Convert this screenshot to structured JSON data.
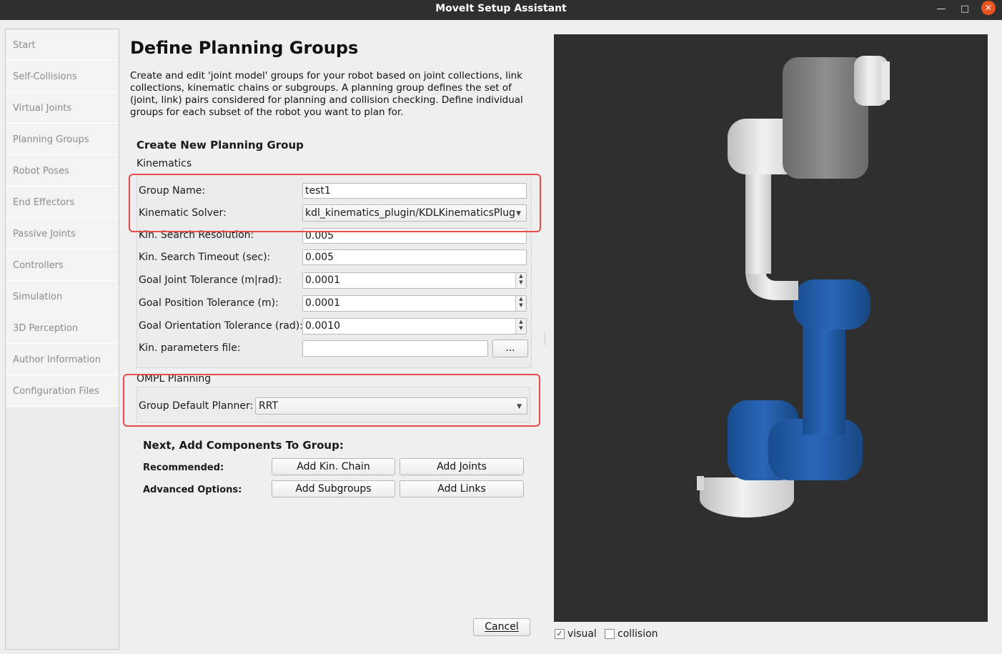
{
  "window": {
    "title": "MoveIt Setup Assistant"
  },
  "sidebar": {
    "items": [
      {
        "label": "Start"
      },
      {
        "label": "Self-Collisions"
      },
      {
        "label": "Virtual Joints"
      },
      {
        "label": "Planning Groups"
      },
      {
        "label": "Robot Poses"
      },
      {
        "label": "End Effectors"
      },
      {
        "label": "Passive Joints"
      },
      {
        "label": "Controllers"
      },
      {
        "label": "Simulation"
      },
      {
        "label": "3D Perception"
      },
      {
        "label": "Author Information"
      },
      {
        "label": "Configuration Files"
      }
    ]
  },
  "page": {
    "title": "Define Planning Groups",
    "description": "Create and edit 'joint model' groups for your robot based on joint collections, link collections, kinematic chains or subgroups. A planning group defines the set of (joint, link) pairs considered for planning and collision checking. Define individual groups for each subset of the robot you want to plan for."
  },
  "form": {
    "section_title": "Create New Planning Group",
    "kinematics_title": "Kinematics",
    "group_name_label": "Group Name:",
    "group_name_value": "test1",
    "solver_label": "Kinematic Solver:",
    "solver_value": "kdl_kinematics_plugin/KDLKinematicsPlug",
    "resolution_label": "Kin. Search Resolution:",
    "resolution_value": "0.005",
    "timeout_label": "Kin. Search Timeout (sec):",
    "timeout_value": "0.005",
    "joint_tol_label": "Goal Joint Tolerance (m|rad):",
    "joint_tol_value": "0.0001",
    "pos_tol_label": "Goal Position Tolerance (m):",
    "pos_tol_value": "0.0001",
    "orient_tol_label": "Goal Orientation Tolerance (rad):",
    "orient_tol_value": "0.0010",
    "params_file_label": "Kin. parameters file:",
    "params_file_value": "",
    "browse_label": "...",
    "ompl_title": "OMPL Planning",
    "planner_label": "Group Default Planner:",
    "planner_value": "RRT"
  },
  "components": {
    "title": "Next, Add Components To Group:",
    "recommended_label": "Recommended:",
    "advanced_label": "Advanced Options:",
    "add_chain": "Add Kin. Chain",
    "add_joints": "Add Joints",
    "add_subgroups": "Add Subgroups",
    "add_links": "Add Links"
  },
  "footer": {
    "cancel_label": "Cancel"
  },
  "viewer": {
    "visual_label": "visual",
    "visual_checked": true,
    "collision_label": "collision",
    "collision_checked": false,
    "colors": {
      "background": "#2f2f2f",
      "blue_link": "#1f5aa6",
      "white_link": "#e2e2e2",
      "grey_link": "#7d7d7d"
    }
  }
}
